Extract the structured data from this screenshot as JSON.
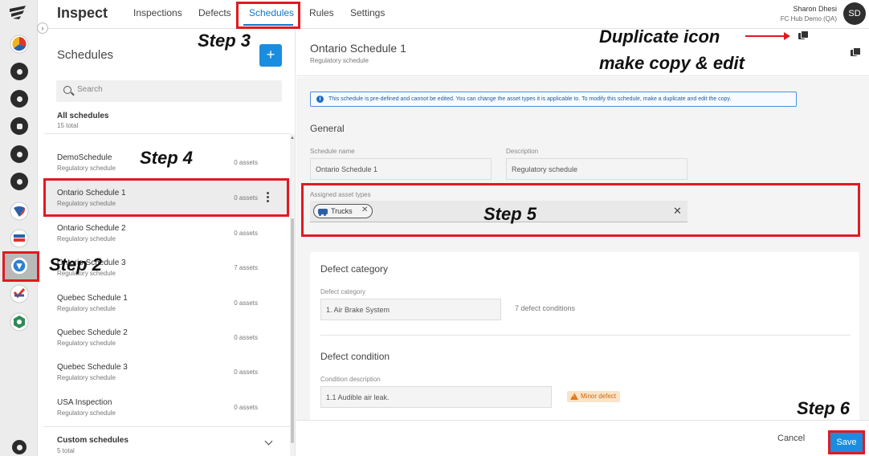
{
  "header": {
    "app_title": "Inspect",
    "tabs": [
      "Inspections",
      "Defects",
      "Schedules",
      "Rules",
      "Settings"
    ],
    "active_tab": "Schedules",
    "user_name": "Sharon Dhesi",
    "user_org": "FC Hub Demo (QA)",
    "avatar_initials": "SD"
  },
  "rail": {
    "icons": [
      "app-logo",
      "pie-chart-icon",
      "bar-chart-icon",
      "location-icon",
      "list-icon",
      "wrench-icon",
      "gear-icon",
      "app-icon-1",
      "app-icon-2",
      "inspect-app-icon",
      "app-icon-3",
      "app-icon-4",
      "close-icon"
    ]
  },
  "schedules_panel": {
    "title": "Schedules",
    "add_label": "+",
    "search_placeholder": "Search",
    "all_heading": "All schedules",
    "all_count": "15 total",
    "items": [
      {
        "name": "DemoSchedule",
        "type": "Regulatory schedule",
        "assets": "0 assets"
      },
      {
        "name": "Ontario Schedule 1",
        "type": "Regulatory schedule",
        "assets": "0 assets"
      },
      {
        "name": "Ontario Schedule 2",
        "type": "Regulatory schedule",
        "assets": "0 assets"
      },
      {
        "name": "Ontario Schedule 3",
        "type": "Regulatory schedule",
        "assets": "7 assets"
      },
      {
        "name": "Quebec Schedule 1",
        "type": "Regulatory schedule",
        "assets": "0 assets"
      },
      {
        "name": "Quebec Schedule 2",
        "type": "Regulatory schedule",
        "assets": "0 assets"
      },
      {
        "name": "Quebec Schedule 3",
        "type": "Regulatory schedule",
        "assets": "0 assets"
      },
      {
        "name": "USA Inspection",
        "type": "Regulatory schedule",
        "assets": "0 assets"
      }
    ],
    "selected": "Ontario Schedule 1",
    "custom_heading": "Custom schedules",
    "custom_count": "5 total"
  },
  "detail": {
    "title": "Ontario Schedule 1",
    "subtitle": "Regulatory schedule",
    "info": "This schedule is pre-defined and cannot be edited. You can change the asset types it is applicable to. To modify this schedule, make a duplicate and edit the copy.",
    "general_heading": "General",
    "name_label": "Schedule name",
    "name_value": "Ontario Schedule 1",
    "desc_label": "Description",
    "desc_value": "Regulatory schedule",
    "assets_label": "Assigned asset types",
    "asset_chip": "Trucks",
    "chip_close": "✕",
    "clear_symbol": "✕",
    "defect_category_heading": "Defect category",
    "defect_category_label": "Defect category",
    "defect_category_value": "1. Air Brake System",
    "defect_conditions": "7 defect conditions",
    "defect_condition_heading": "Defect condition",
    "condition_desc_label": "Condition description",
    "condition_desc_value": "1.1 Audible air leak.",
    "severity": "Minor defect"
  },
  "footer": {
    "cancel_label": "Cancel",
    "save_label": "Save"
  },
  "annotations": {
    "step2": "Step 2",
    "step3": "Step 3",
    "step4": "Step 4",
    "step5": "Step 5",
    "step6": "Step 6",
    "duplicate_line1": "Duplicate icon",
    "duplicate_line2": "make copy & edit",
    "box_color": "#e01a22"
  }
}
